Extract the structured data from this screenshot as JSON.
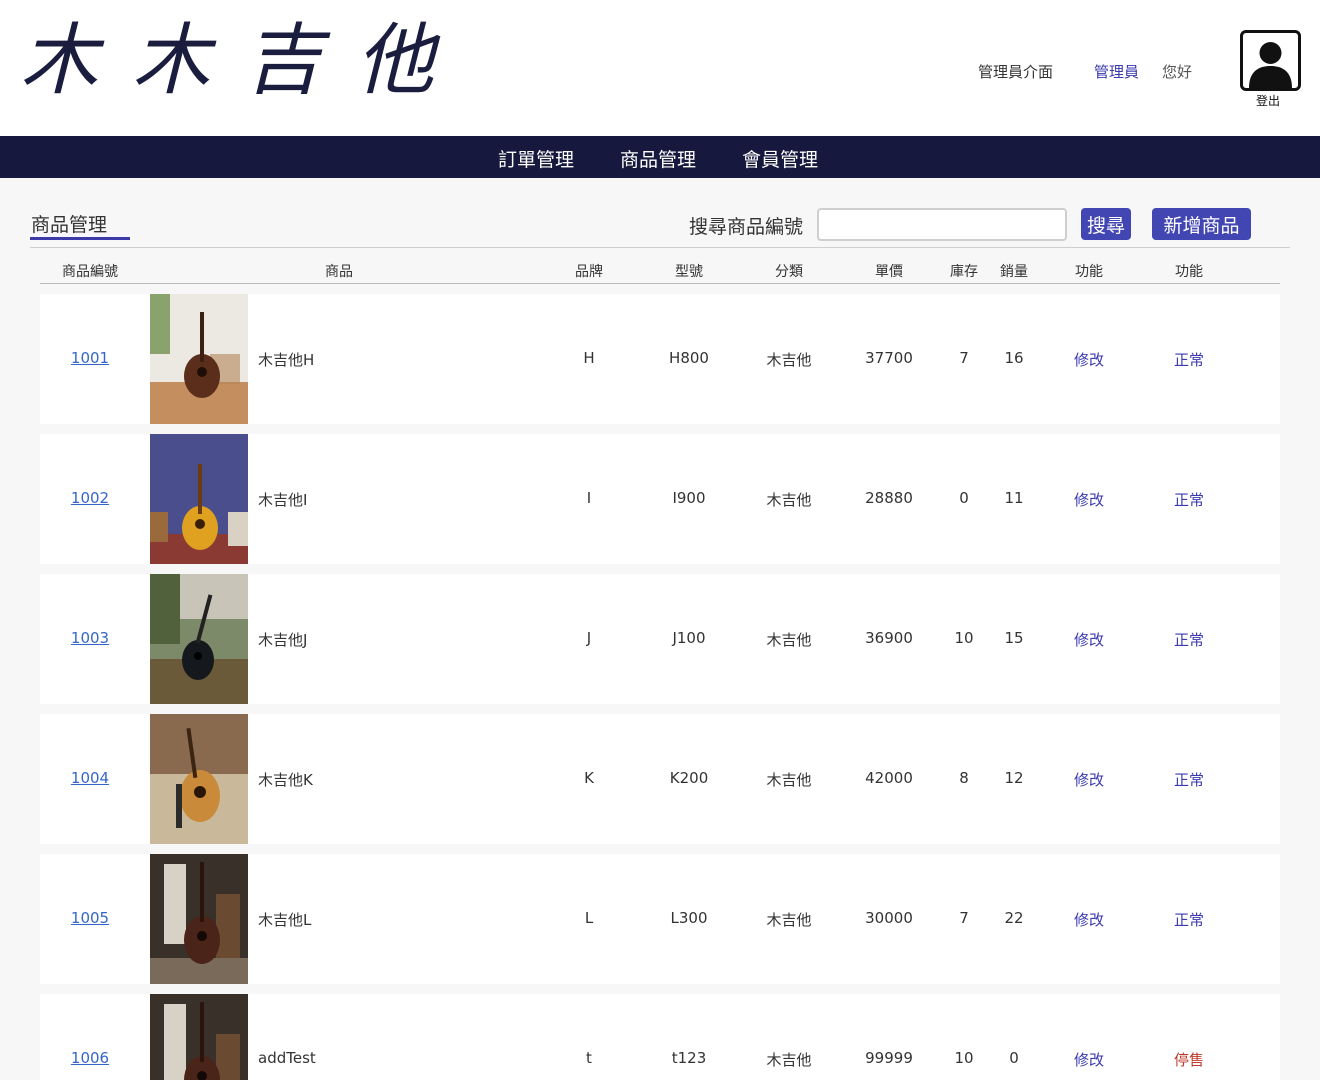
{
  "header": {
    "logo_text": "木木吉他",
    "admin_interface_label": "管理員介面",
    "admin_name": "管理員",
    "greeting": "您好",
    "logout_label": "登出"
  },
  "nav": {
    "items": [
      "訂單管理",
      "商品管理",
      "會員管理"
    ]
  },
  "page": {
    "title": "商品管理",
    "search_label": "搜尋商品編號",
    "search_value": "",
    "search_button": "搜尋",
    "add_button": "新增商品"
  },
  "table": {
    "headers": {
      "id": "商品編號",
      "product": "商品",
      "brand": "品牌",
      "model": "型號",
      "category": "分類",
      "price": "單價",
      "stock": "庫存",
      "sales": "銷量",
      "action": "功能",
      "status": "功能"
    },
    "rows": [
      {
        "id": "1001",
        "name": "木吉他H",
        "brand": "H",
        "model": "H800",
        "category": "木吉他",
        "price": "37700",
        "stock": "7",
        "sales": "16",
        "edit": "修改",
        "status": "正常",
        "status_color": "#3a39b0",
        "image": "guitar-on-wood-floor"
      },
      {
        "id": "1002",
        "name": "木吉他I",
        "brand": "I",
        "model": "I900",
        "category": "木吉他",
        "price": "28880",
        "stock": "0",
        "sales": "11",
        "edit": "修改",
        "status": "正常",
        "status_color": "#3a39b0",
        "image": "guitar-against-blue-wall"
      },
      {
        "id": "1003",
        "name": "木吉他J",
        "brand": "J",
        "model": "J100",
        "category": "木吉他",
        "price": "36900",
        "stock": "10",
        "sales": "15",
        "edit": "修改",
        "status": "正常",
        "status_color": "#3a39b0",
        "image": "guitar-in-grass"
      },
      {
        "id": "1004",
        "name": "木吉他K",
        "brand": "K",
        "model": "K200",
        "category": "木吉他",
        "price": "42000",
        "stock": "8",
        "sales": "12",
        "edit": "修改",
        "status": "正常",
        "status_color": "#3a39b0",
        "image": "guitar-on-chair"
      },
      {
        "id": "1005",
        "name": "木吉他L",
        "brand": "L",
        "model": "L300",
        "category": "木吉他",
        "price": "30000",
        "stock": "7",
        "sales": "22",
        "edit": "修改",
        "status": "正常",
        "status_color": "#3a39b0",
        "image": "guitar-in-dark-room"
      },
      {
        "id": "1006",
        "name": "addTest",
        "brand": "t",
        "model": "t123",
        "category": "木吉他",
        "price": "99999",
        "stock": "10",
        "sales": "0",
        "edit": "修改",
        "status": "停售",
        "status_color": "#c0392b",
        "image": "guitar-in-dark-room"
      }
    ]
  },
  "colors": {
    "navbar": "#16183e",
    "accent": "#4246b3",
    "link": "#3466c9"
  }
}
